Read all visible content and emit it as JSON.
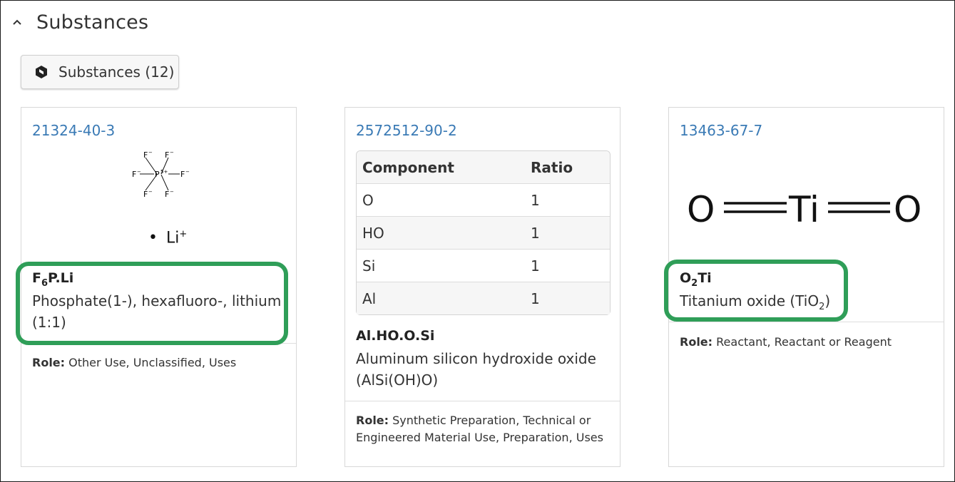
{
  "section": {
    "title": "Substances"
  },
  "substances_button": {
    "label": "Substances (12)"
  },
  "cards": [
    {
      "cas": "21324-40-3",
      "structure_ion": "Li",
      "structure_ion_charge": "+",
      "structure_center": "P",
      "structure_center_charge": "5+",
      "structure_ligand": "F",
      "structure_ligand_charge": "−",
      "formula_parts": [
        "F",
        "6",
        "P.Li"
      ],
      "name": "Phosphate(1-), hexafluoro-, lithium (1:1)",
      "role_label": "Role:",
      "role_value": "Other Use, Unclassified, Uses"
    },
    {
      "cas": "2572512-90-2",
      "table_headers": [
        "Component",
        "Ratio"
      ],
      "table_rows": [
        [
          "O",
          "1"
        ],
        [
          "HO",
          "1"
        ],
        [
          "Si",
          "1"
        ],
        [
          "Al",
          "1"
        ]
      ],
      "formula": "Al.HO.O.Si",
      "name": "Aluminum silicon hydroxide oxide (AlSi(OH)O)",
      "role_label": "Role:",
      "role_value": "Synthetic Preparation, Technical or Engineered Material Use, Preparation, Uses"
    },
    {
      "cas": "13463-67-7",
      "structure_left": "O",
      "structure_center": "Ti",
      "structure_right": "O",
      "formula_parts": [
        "O",
        "2",
        "Ti"
      ],
      "name_parts": [
        "Titanium oxide (TiO",
        "2",
        ")"
      ],
      "role_label": "Role:",
      "role_value": "Reactant, Reactant or Reagent"
    }
  ],
  "colors": {
    "link": "#3a7ab5",
    "highlight": "#2f9e58"
  }
}
